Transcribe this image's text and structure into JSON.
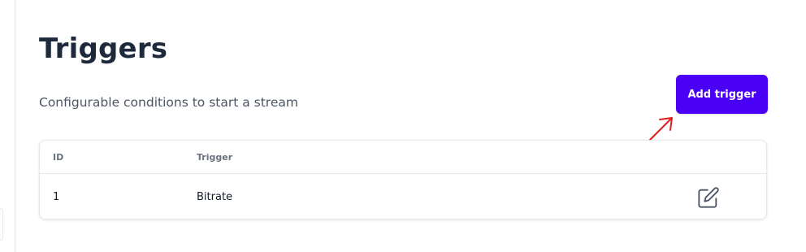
{
  "header": {
    "title": "Triggers",
    "subtitle": "Configurable conditions to start a stream"
  },
  "actions": {
    "add_trigger_label": "Add trigger"
  },
  "table": {
    "columns": [
      "ID",
      "Trigger"
    ],
    "rows": [
      {
        "id": "1",
        "trigger": "Bitrate",
        "action_icon": "edit-icon"
      }
    ]
  },
  "colors": {
    "accent": "#4a00f5",
    "annotation_arrow": "#e31b1b",
    "title": "#1e293b"
  }
}
